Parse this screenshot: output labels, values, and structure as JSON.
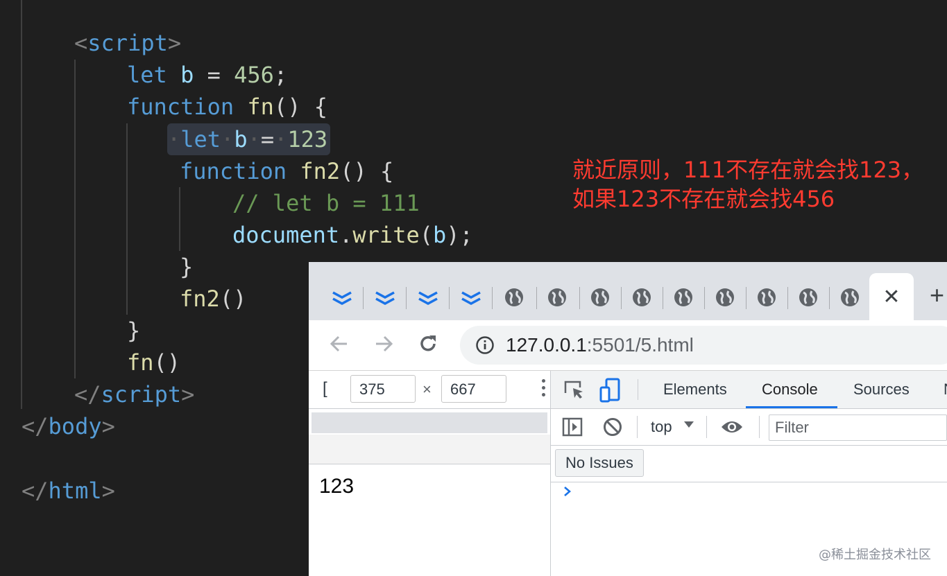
{
  "editor": {
    "lines": {
      "script_open": {
        "open": "<",
        "tag": "script",
        "close": ">"
      },
      "let_b_456": {
        "kw": "let",
        "var": "b",
        "op": "=",
        "num": "456",
        "end": ";"
      },
      "fn_decl": {
        "kw": "function",
        "name": "fn",
        "rest": "() {"
      },
      "let_b_123": {
        "kw": "let",
        "var": "b",
        "op": "=",
        "num": "123"
      },
      "fn2_decl": {
        "kw": "function",
        "name": "fn2",
        "rest": "() {"
      },
      "comment": "// let b = 111",
      "doc_write": {
        "obj": "document",
        "dot": ".",
        "method": "write",
        "open": "(",
        "arg": "b",
        "close": ");"
      },
      "close_fn2": "}",
      "call_fn2": {
        "name": "fn2",
        "rest": "()"
      },
      "close_fn": "}",
      "call_fn": {
        "name": "fn",
        "rest": "()"
      },
      "script_close": {
        "open": "</",
        "tag": "script",
        "close": ">"
      },
      "body_close": {
        "open": "</",
        "tag": "body",
        "close": ">"
      },
      "html_close": {
        "open": "</",
        "tag": "html",
        "close": ">"
      }
    }
  },
  "annotation": {
    "line1": "就近原则，111不存在就会找123，",
    "line2": "如果123不存在就会找456"
  },
  "browser": {
    "tabs": {
      "close_glyph": "✕",
      "new_tab_glyph": "+"
    },
    "omnibox": {
      "host": "127.0.0.1",
      "path": ":5501/5.html"
    },
    "device_toolbar": {
      "mode_glyph": "[",
      "width": "375",
      "times": "×",
      "height": "667"
    },
    "viewport": {
      "output": "123"
    },
    "devtools": {
      "tabs": [
        "Elements",
        "Console",
        "Sources",
        "N"
      ],
      "active_tab": "Console",
      "context": "top",
      "filter_placeholder": "Filter",
      "issues": "No Issues",
      "prompt": "›"
    }
  },
  "watermark": "@稀土掘金技术社区",
  "colors": {
    "editor_bg": "#1f1f1f",
    "annotation": "#ff3b30",
    "accent_blue": "#1a73e8"
  }
}
